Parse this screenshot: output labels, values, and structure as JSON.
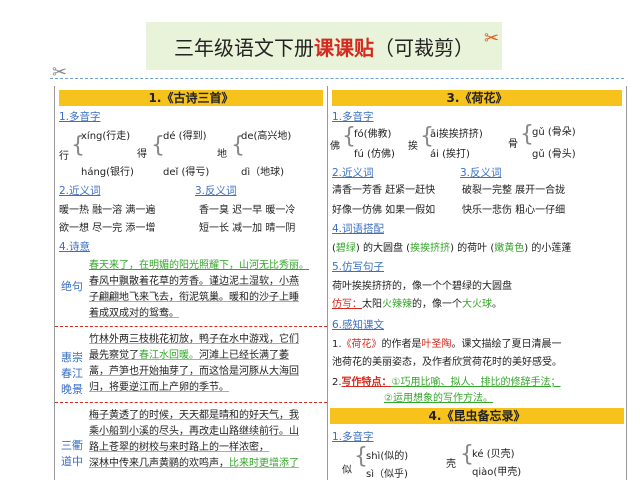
{
  "title": {
    "main": "三年级语文下册",
    "highlight": "课课贴",
    "suffix": "（可裁剪）"
  },
  "left": {
    "band": "1.《古诗三首》",
    "s1": "1.多音字",
    "poly": {
      "xing": "行",
      "xing_a": "xíng(行走)",
      "xing_b": "háng(银行)",
      "de": "得",
      "de_a": "dé (得到)",
      "de_b": "deǐ (得亏)",
      "di": "地",
      "di_a": "de(高兴地)",
      "di_b": "dì（地球)"
    },
    "s2": "2.近义词",
    "syn1": "暖一热  融一溶   满一遍",
    "syn2": "欲一想  尽一完   添一增",
    "s3": "3.反义词",
    "ant1": "香一臭  迟一早  暖一冷",
    "ant2": "短一长  减一加  晴一阴",
    "s4": "4.诗意",
    "p1_title": "绝句",
    "p1_green": "春天来了，在明媚的阳光照耀下，山河无比秀丽。",
    "p1_lines": [
      "春风中飘散着花草的芳香。谨边泥土湿软，小燕",
      "子翩翩地飞来飞去，衔泥筑巢。暖和的沙子上睡",
      "着成双成对的鸳鸯。"
    ],
    "p2_title": "惠崇春江晚景",
    "p2_lines_a": "竹林外两三枝桃花初放，鸭子在水中游戏，它们",
    "p2_lines_b": "最先察觉了",
    "p2_green": "春江水回暖。",
    "p2_lines_c": "河滩上已经长满了萎",
    "p2_lines_rest": [
      "蒿，芦笋也开始抽芽了，而这恰是河豚从大海回",
      "归，将要逆江而上产卵的季节。"
    ],
    "p3_title": "三衢道中",
    "p3_lines": [
      "梅子黄透了的时候，天天都是晴和的好天气，我",
      "乘小船到小溪的尽头，再改走山路继续前行。山",
      "路上苍翠的树校与来时路上的一样浓密，"
    ],
    "p3_tail_a": "深林中传来几声黄鹂的欢鸣声，",
    "p3_tail_green": "比来时更增添了"
  },
  "right": {
    "band1": "3.《荷花》",
    "s1": "1.多音字",
    "fo": "佛",
    "fo_a": "fó(佛教)",
    "fo_b": "fú (仿佛)",
    "ai": "挨",
    "ai_a": "āi挨挨挤挤)",
    "ai_b": "ái (挨打)",
    "gu": "骨",
    "gu_a": "gǔ (骨朵)",
    "gu_b": "gǔ  (骨头)",
    "s2": "2.近义词",
    "syn1": "清香一芳香  赶紧一赶快",
    "syn2": "好像一仿佛  如果一假如",
    "s3": "3.反义词",
    "ant1": "破裂一完整  展开一合拢",
    "ant2": "快乐一悲伤  粗心一仔细",
    "s4": "4.词语搭配",
    "coll_a": "(",
    "coll_b": "碧绿",
    "coll_c": ") 的大圆盘 (",
    "coll_d": "挨挨挤挤",
    "coll_e": ") 的荷叶 (",
    "coll_f": "嫩黄色",
    "coll_g": ") 的小莲蓬",
    "s5": "5.仿写句子",
    "imit1": "荷叶挨挨挤挤的，像一个个碧绿的大圆盘",
    "imit2_a": "仿写：",
    "imit2_b": "太阳",
    "imit2_c": "火辣辣",
    "imit2_d": "的，像一个",
    "imit2_e": "大火球",
    "imit2_f": "。",
    "s6": "6.感知课文",
    "perc_a": "1.",
    "perc_b": "《荷花》",
    "perc_c": "的作者是",
    "perc_d": "叶圣陶",
    "perc_e": "。课文描绘了夏日清晨一",
    "perc_line2": "池荷花的美丽姿态，及作者欣赏荷花时的美好感受。",
    "perc3_a": "2.",
    "perc3_b": "写作特点：",
    "perc3_c": "①巧用比喻、拟人、排比的修辞手法；",
    "perc4": "②运用想象的写作方法。",
    "band2": "4.《昆虫备忘录》",
    "s7": "1.多音字",
    "si": "似",
    "si_a": "shì(似的)",
    "si_b": "sì（似乎)",
    "ke": "壳",
    "ke_a": "ké (贝壳)",
    "ke_b": "qiào(甲壳)"
  }
}
